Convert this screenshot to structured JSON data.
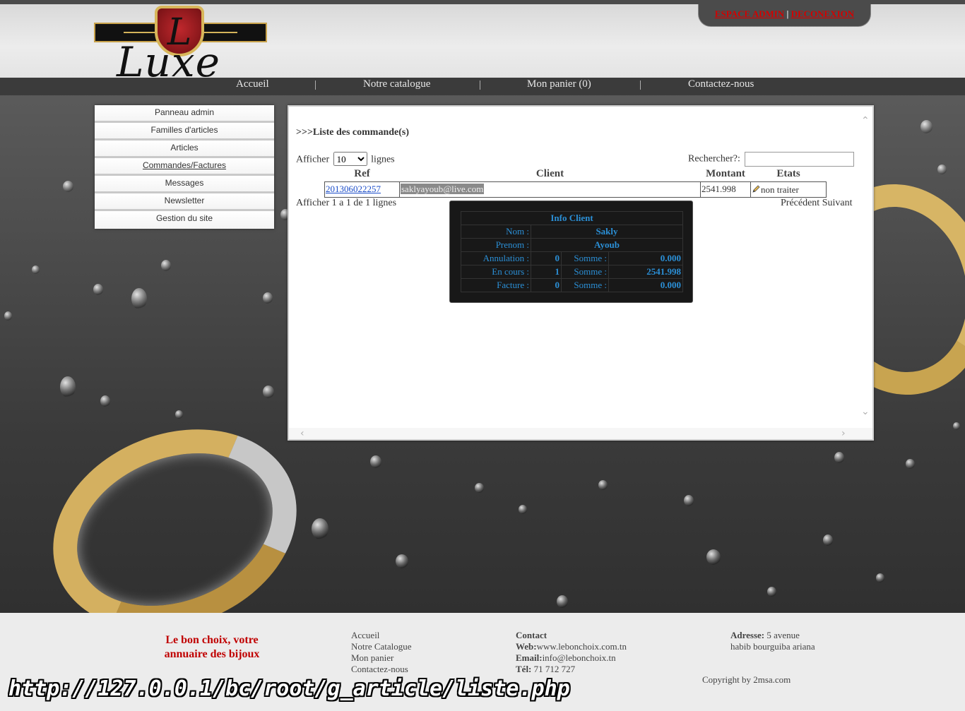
{
  "header": {
    "logo_letter": "L",
    "logo_text": "Luxe",
    "admin_link": "ESPACE ADMIN",
    "separator": "|",
    "logout_link": "DECONEXION"
  },
  "nav": {
    "items": [
      "Accueil",
      "Notre catalogue",
      "Mon panier (0)",
      "Contactez-nous"
    ],
    "separator": "|"
  },
  "sidebar": {
    "items": [
      "Panneau admin",
      "Familles d'articles",
      "Articles",
      "Commandes/Factures",
      "Messages",
      "Newsletter",
      "Gestion du site"
    ]
  },
  "main": {
    "title": ">>>Liste des commande(s)",
    "show_label": "Afficher",
    "show_value": "10",
    "show_suffix": "lignes",
    "search_label": "Rechercher?:",
    "search_value": "",
    "columns": [
      "Ref",
      "Client",
      "Montant",
      "Etats"
    ],
    "rows": [
      {
        "ref": "201306022257",
        "client": "saklyayoub@live.com",
        "montant": "2541.998",
        "etat": "non traiter"
      }
    ],
    "info_text": "Afficher 1 a 1 de 1 lignes",
    "prev": "Précédent",
    "next": "Suivant"
  },
  "info_client": {
    "title": "Info Client",
    "nom_label": "Nom :",
    "nom": "Sakly",
    "prenom_label": "Prenom :",
    "prenom": "Ayoub",
    "annulation_label": "Annulation :",
    "annulation_count": "0",
    "encours_label": "En cours :",
    "encours_count": "1",
    "facture_label": "Facture :",
    "facture_count": "0",
    "somme_label": "Somme :",
    "annulation_somme": "0.000",
    "encours_somme": "2541.998",
    "facture_somme": "0.000"
  },
  "footer": {
    "slogan": "Le bon choix, votre annuaire des bijoux",
    "links": [
      "Accueil",
      "Notre Catalogue",
      "Mon panier",
      "Contactez-nous"
    ],
    "contact_title": "Contact",
    "web_label": "Web:",
    "web": "www.lebonchoix.com.tn",
    "email_label": "Email:",
    "email": "info@lebonchoix.tn",
    "tel_label": "Tél:",
    "tel": "71 712 727",
    "address_label": "Adresse:",
    "address": "5 avenue habib bourguiba ariana",
    "copyright": "Copyright by 2msa.com"
  },
  "url_overlay": "http://127.0.0.1/bc/root/g_article/liste.php",
  "colors": {
    "nav_bg": "#3b3b3b",
    "admin_link": "#d40000",
    "info_text": "#2b8fd6",
    "slogan": "#c00000"
  }
}
